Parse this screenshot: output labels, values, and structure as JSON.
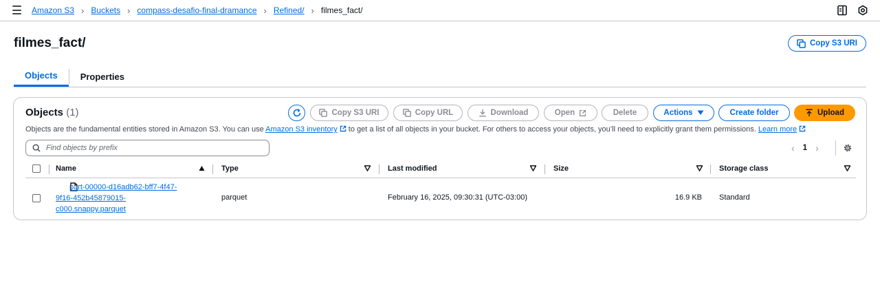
{
  "breadcrumbs": [
    {
      "label": "Amazon S3"
    },
    {
      "label": "Buckets"
    },
    {
      "label": "compass-desafio-final-dramance"
    },
    {
      "label": "Refined/"
    }
  ],
  "breadcrumb_current": "filmes_fact/",
  "page_title": "filmes_fact/",
  "header_actions": {
    "copy_s3_uri": "Copy S3 URI"
  },
  "tabs": [
    {
      "label": "Objects",
      "active": true
    },
    {
      "label": "Properties",
      "active": false
    }
  ],
  "objects_panel": {
    "title": "Objects",
    "count": "(1)",
    "toolbar": {
      "copy_s3_uri": "Copy S3 URI",
      "copy_url": "Copy URL",
      "download": "Download",
      "open": "Open",
      "delete": "Delete",
      "actions": "Actions",
      "create_folder": "Create folder",
      "upload": "Upload"
    },
    "description_part1": "Objects are the fundamental entities stored in Amazon S3. You can use ",
    "description_link1": "Amazon S3 inventory",
    "description_part2": " to get a list of all objects in your bucket. For others to access your objects, you’ll need to explicitly grant them permissions. ",
    "description_link2": "Learn more",
    "search_placeholder": "Find objects by prefix",
    "pagination": {
      "current_page": "1"
    },
    "columns": [
      "Name",
      "Type",
      "Last modified",
      "Size",
      "Storage class"
    ],
    "rows": [
      {
        "name_line1": "part-00000-d16adb62-bff7-4f47-",
        "name_line2": "9f16-452b45879015-",
        "name_line3": "c000.snappy.parquet",
        "type": "parquet",
        "last_modified": "February 16, 2025, 09:30:31 (UTC-03:00)",
        "size": "16.9 KB",
        "storage_class": "Standard"
      }
    ]
  },
  "colors": {
    "primary": "#006ce0",
    "upload": "#ff9900",
    "border": "#c6c6cd",
    "text": "#0f141a"
  },
  "icons": [
    "menu-icon",
    "chevron-right-icon",
    "panel-icon",
    "info-circle-icon",
    "copy-icon",
    "refresh-icon",
    "download-icon",
    "external-link-icon",
    "caret-down-icon",
    "upload-icon",
    "search-icon",
    "chevron-left-icon",
    "settings-icon",
    "sort-icon",
    "file-icon"
  ]
}
